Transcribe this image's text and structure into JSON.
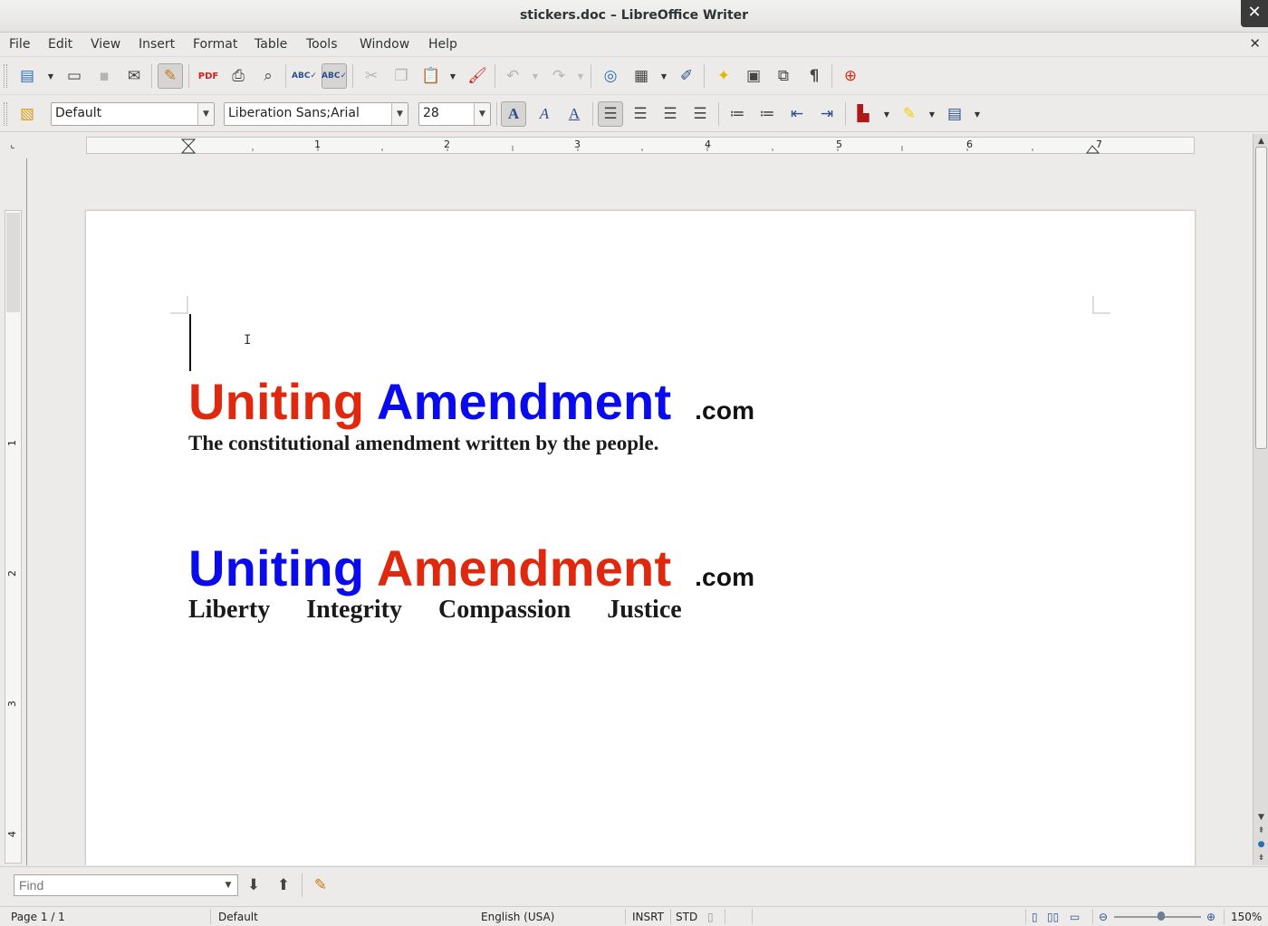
{
  "window": {
    "title": "stickers.doc – LibreOffice Writer",
    "close_glyph": "✕"
  },
  "menu": [
    "File",
    "Edit",
    "View",
    "Insert",
    "Format",
    "Table",
    "Tools",
    "Window",
    "Help"
  ],
  "formatting": {
    "paragraph_style": "Default",
    "font_name": "Liberation Sans;Arial",
    "font_size": "28"
  },
  "ruler": {
    "h_labels": [
      "1",
      "2",
      "3",
      "4",
      "5",
      "6",
      "7"
    ],
    "v_labels": [
      "1",
      "2",
      "3",
      "4"
    ]
  },
  "document": {
    "line1": {
      "word1": "Uniting",
      "word2": "Amendment",
      "suffix": ".com",
      "color1": "#e0280f",
      "color2": "#0a0aee"
    },
    "tagline": "The constitutional amendment written by the people.",
    "line2": {
      "word1": "Uniting",
      "word2": "Amendment",
      "suffix": ".com",
      "color1": "#0a0aee",
      "color2": "#e0280f"
    },
    "values": [
      "Liberty",
      "Integrity",
      "Compassion",
      "Justice"
    ]
  },
  "find": {
    "placeholder": "Find"
  },
  "status": {
    "page": "Page 1 / 1",
    "style": "Default",
    "language": "English (USA)",
    "insert_mode": "INSRT",
    "selection_mode": "STD",
    "zoom": "150%"
  }
}
